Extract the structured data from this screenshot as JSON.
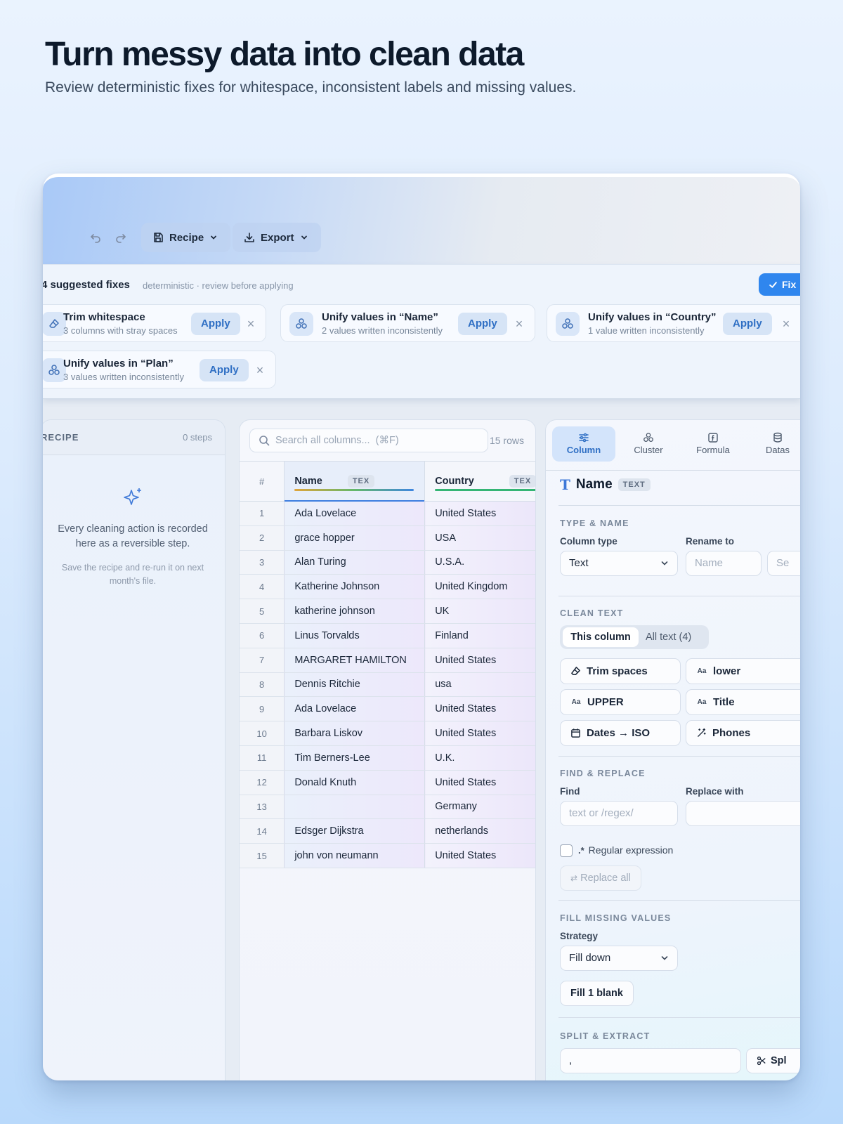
{
  "hero": {
    "title": "Turn messy data into clean data",
    "subtitle": "Review deterministic fixes for whitespace, inconsistent labels and missing values."
  },
  "toolbar": {
    "undo_icon": "undo-icon",
    "redo_icon": "redo-icon",
    "recipe_label": "Recipe",
    "export_label": "Export"
  },
  "fixes": {
    "title": "4 suggested fixes",
    "subtitle": "deterministic · review before applying",
    "fix_all_label": "Fix",
    "apply_label": "Apply",
    "close_glyph": "×",
    "cards": [
      {
        "title": "Trim whitespace",
        "sub": "3 columns with stray spaces"
      },
      {
        "title": "Unify values in “Name”",
        "sub": "2 values written inconsistently"
      },
      {
        "title": "Unify values in “Country”",
        "sub": "1 value written inconsistently"
      },
      {
        "title": "Unify values in “Plan”",
        "sub": "3 values written inconsistently"
      }
    ]
  },
  "recipe": {
    "title": "RECIPE",
    "steps": "0 steps",
    "empty_line1": "Every cleaning action is recorded",
    "empty_line2": "here as a reversible step.",
    "hint_line1": "Save the recipe and re-run it on next",
    "hint_line2": "month's file."
  },
  "table": {
    "search_placeholder": "Search all columns...  (⌘F)",
    "row_count": "15 rows",
    "headers": {
      "num": "#",
      "name": "Name",
      "country": "Country",
      "type_tag": "TEX"
    },
    "rows": [
      {
        "n": "1",
        "name": "Ada Lovelace",
        "country": "United States"
      },
      {
        "n": "2",
        "name": "grace hopper",
        "country": "USA"
      },
      {
        "n": "3",
        "name": "Alan Turing",
        "country": "U.S.A."
      },
      {
        "n": "4",
        "name": "Katherine Johnson",
        "country": "United Kingdom"
      },
      {
        "n": "5",
        "name": "katherine johnson",
        "country": "UK"
      },
      {
        "n": "6",
        "name": "Linus Torvalds",
        "country": "Finland"
      },
      {
        "n": "7",
        "name": "MARGARET HAMILTON",
        "country": "United States"
      },
      {
        "n": "8",
        "name": "Dennis Ritchie",
        "country": "usa"
      },
      {
        "n": "9",
        "name": "Ada Lovelace",
        "country": "United States"
      },
      {
        "n": "10",
        "name": "Barbara Liskov",
        "country": "United States"
      },
      {
        "n": "11",
        "name": "Tim Berners-Lee",
        "country": "U.K."
      },
      {
        "n": "12",
        "name": "Donald Knuth",
        "country": "United States"
      },
      {
        "n": "13",
        "name": "",
        "country": "Germany"
      },
      {
        "n": "14",
        "name": "Edsger Dijkstra",
        "country": "netherlands"
      },
      {
        "n": "15",
        "name": "john von neumann",
        "country": "United States"
      }
    ]
  },
  "side": {
    "tabs": [
      "Column",
      "Cluster",
      "Formula",
      "Datas"
    ],
    "column_name": "Name",
    "column_tag": "TEXT",
    "type_name": {
      "section": "TYPE & NAME",
      "type_label": "Column type",
      "type_value": "Text",
      "rename_label": "Rename to",
      "rename_placeholder": "Name",
      "extra_placeholder": "Se"
    },
    "clean_text": {
      "section": "CLEAN TEXT",
      "seg_active": "This column",
      "seg_other": "All text (4)",
      "case_glyph": "Aa",
      "chips": [
        "Trim spaces",
        "lower",
        "UPPER",
        "Title",
        "Dates → ISO",
        "Phones"
      ]
    },
    "find_replace": {
      "section": "FIND & REPLACE",
      "find_label": "Find",
      "find_placeholder": "text or /regex/",
      "replace_label": "Replace with",
      "regex_label": "Regular expression",
      "replace_all": "Replace all"
    },
    "fill_missing": {
      "section": "FILL MISSING VALUES",
      "strategy_label": "Strategy",
      "strategy_value": "Fill down",
      "fill_button": "Fill 1 blank"
    },
    "split": {
      "section": "SPLIT & EXTRACT",
      "delimiter": ",",
      "split_button": "Spl"
    }
  }
}
